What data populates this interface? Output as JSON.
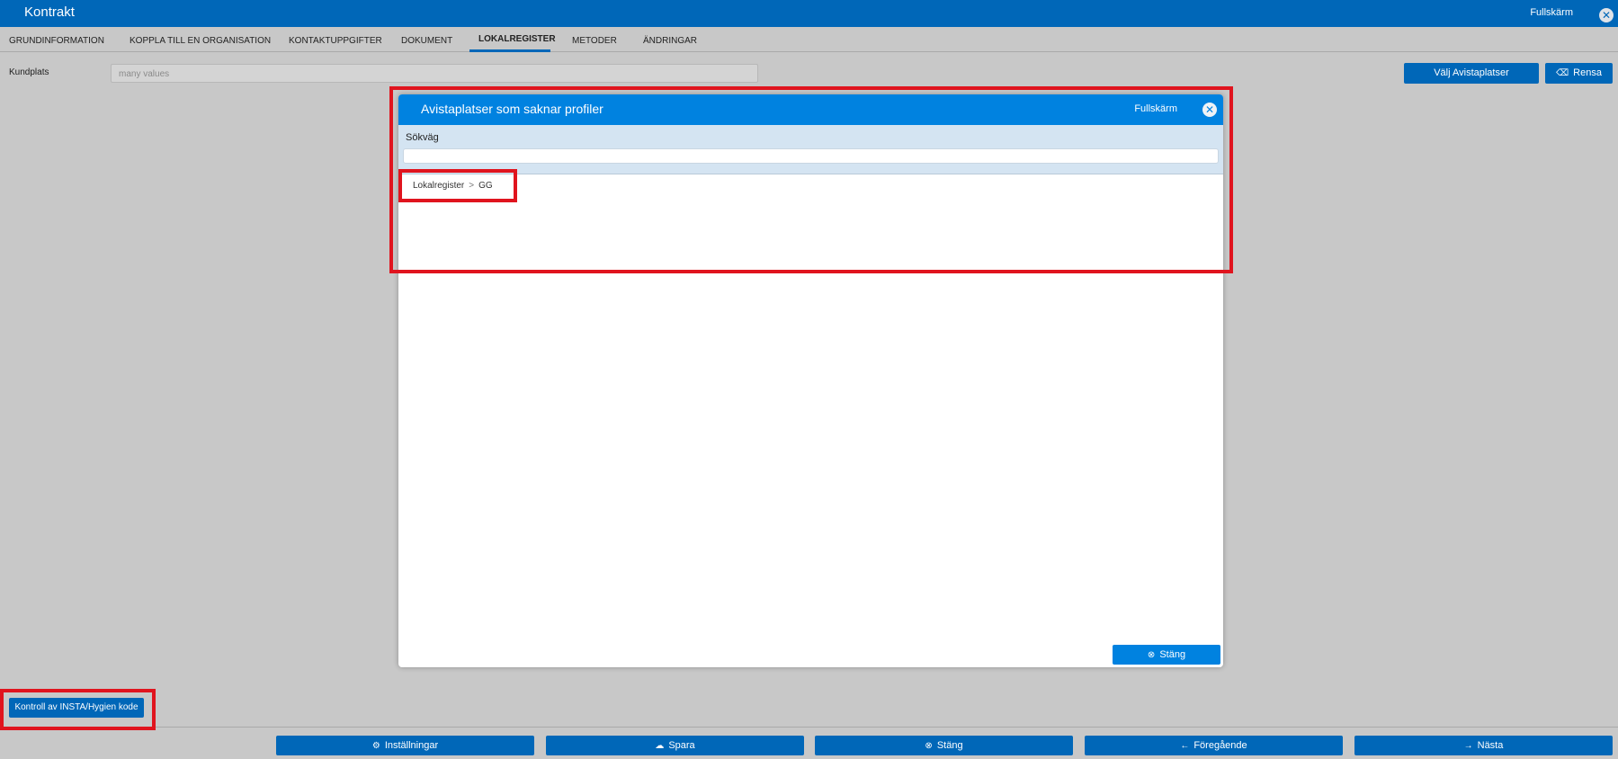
{
  "window": {
    "title": "Kontrakt",
    "fullscreen_label": "Fullskärm",
    "close_icon": "circle-x-icon"
  },
  "tabs": [
    {
      "label": "GRUNDINFORMATION",
      "active": false
    },
    {
      "label": "KOPPLA TILL EN ORGANISATION",
      "active": false
    },
    {
      "label": "KONTAKTUPPGIFTER",
      "active": false
    },
    {
      "label": "DOKUMENT",
      "active": false
    },
    {
      "label": "LOKALREGISTER",
      "active": true
    },
    {
      "label": "METODER",
      "active": false
    },
    {
      "label": "ÄNDRINGAR",
      "active": false
    }
  ],
  "form": {
    "kundplats_label": "Kundplats",
    "kundplats_value": "many values"
  },
  "actions": {
    "valj_label": "Välj Avistaplatser",
    "rensa_label": "Rensa",
    "rensa_icon": "eraser-icon"
  },
  "modal": {
    "title": "Avistaplatser som saknar profiler",
    "fullscreen_label": "Fullskärm",
    "search_label": "Sökväg",
    "search_value": "",
    "breadcrumb": [
      "Lokalregister",
      "GG"
    ],
    "close_button_label": "Stäng",
    "close_icon": "circle-x-icon"
  },
  "kontroll_button_label": "Kontroll av INSTA/Hygien kode",
  "bottom_bar": [
    {
      "label": "Inställningar",
      "icon": "gear-icon"
    },
    {
      "label": "Spara",
      "icon": "cloud-upload-icon"
    },
    {
      "label": "Stäng",
      "icon": "circle-x-icon"
    },
    {
      "label": "Föregående",
      "icon": "arrow-left-icon"
    },
    {
      "label": "Nästa",
      "icon": "arrow-right-icon"
    }
  ],
  "colors": {
    "primary": "#0067b8",
    "modal_header": "#0082e0",
    "background": "#c8c8c8",
    "highlight": "#e0141e"
  }
}
